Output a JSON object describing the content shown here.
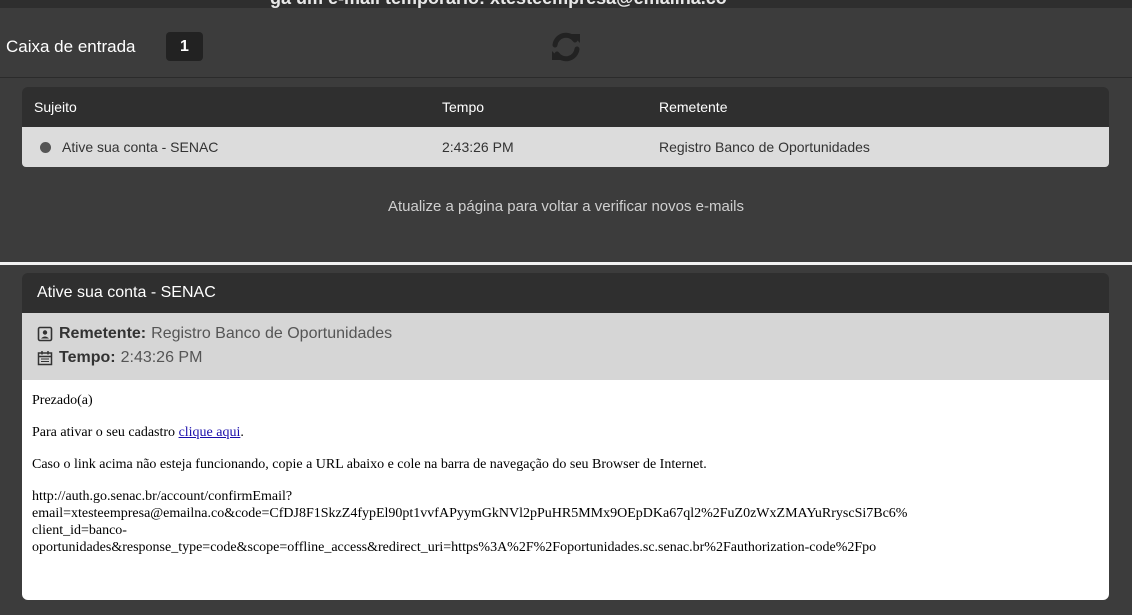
{
  "top_strip": {
    "text": "ga um e-mail temporário: xtesteempresa@emailna.co"
  },
  "inbox": {
    "title": "Caixa de entrada",
    "count": "1",
    "columns": [
      "Sujeito",
      "Tempo",
      "Remetente"
    ],
    "rows": [
      {
        "subject": "Ative sua conta - SENAC",
        "time": "2:43:26 PM",
        "sender": "Registro Banco de Oportunidades"
      }
    ],
    "hint": "Atualize a página para voltar a verificar novos e-mails"
  },
  "message": {
    "title": "Ative sua conta - SENAC",
    "sender_label": "Remetente:",
    "sender_value": "Registro Banco de Oportunidades",
    "time_label": "Tempo:",
    "time_value": "2:43:26 PM",
    "greeting": "Prezado(a)",
    "activate_text": "Para ativar o seu cadastro ",
    "activate_link": "clique aqui",
    "activate_tail": ".",
    "fallback_text": "Caso o link acima não esteja funcionando, copie a URL abaixo e cole na barra de navegação do seu Browser de Internet.",
    "url_lines": [
      "http://auth.go.senac.br/account/confirmEmail?",
      "email=xtesteempresa@emailna.co&code=CfDJ8F1SkzZ4fypEl90pt1vvfAPyymGkNVl2pPuHR5MMx9OEpDKa67ql2%2FuZ0zWxZMAYuRryscSi7Bc6%",
      "client_id=banco-",
      "oportunidades&response_type=code&scope=offline_access&redirect_uri=https%3A%2F%2Foportunidades.sc.senac.br%2Fauthorization-code%2Fpo"
    ]
  },
  "icons": {
    "refresh": "refresh-icon",
    "sender": "contact-card-icon",
    "time": "calendar-icon",
    "unread": "unread-dot-icon"
  },
  "colors": {
    "panel": "#3c3c3c",
    "header": "#2f2f2f",
    "row": "#dcdcdc",
    "link": "#1a0dab"
  }
}
